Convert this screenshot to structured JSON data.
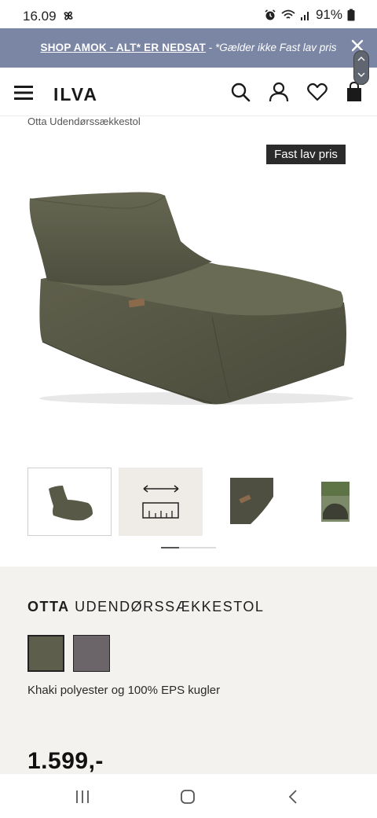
{
  "status_bar": {
    "time": "16.09",
    "battery": "91%",
    "icons": [
      "pinwheel-icon",
      "alarm-icon",
      "wifi-icon",
      "signal-icon",
      "battery-icon"
    ]
  },
  "promo": {
    "link_text": "SHOP AMOK - ALT* ER NEDSAT",
    "separator": " - ",
    "note": "*Gælder ikke Fast lav pris"
  },
  "header": {
    "logo": "ILVA",
    "cart_count": "0",
    "icons": [
      "menu-icon",
      "search-icon",
      "account-icon",
      "wishlist-heart-icon",
      "cart-bag-icon"
    ]
  },
  "product": {
    "breadcrumb": "Otta Udendørssækkestol",
    "badge": "Fast lav pris",
    "name_bold": "OTTA",
    "name_rest": " UDENDØRSSÆKKESTOL",
    "material": "Khaki polyester og 100% EPS kugler",
    "price": "1.599,-",
    "swatches": [
      {
        "name": "khaki",
        "color": "#5d5e4b",
        "selected": true
      },
      {
        "name": "grey",
        "color": "#6b6468",
        "selected": false
      }
    ],
    "gallery_progress": 0.33
  },
  "colors": {
    "promo_bg": "#7a86a3",
    "info_bg": "#f4f2ef",
    "badge_bg": "#2b2b2b"
  }
}
